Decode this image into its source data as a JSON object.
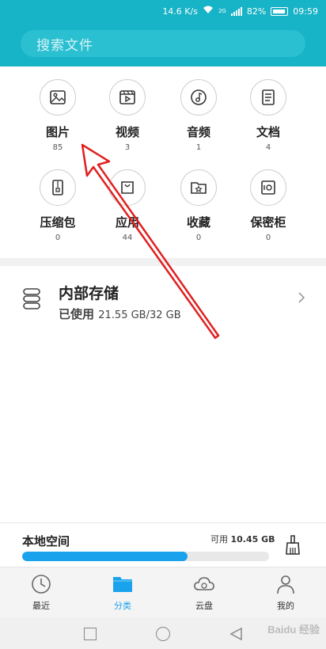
{
  "status": {
    "speed": "14.6 K/s",
    "network": "2G",
    "battery": "82%",
    "time": "09:59"
  },
  "search": {
    "placeholder": "搜索文件"
  },
  "categories": [
    {
      "label": "图片",
      "count": "85",
      "icon": "image-icon"
    },
    {
      "label": "视频",
      "count": "3",
      "icon": "video-icon"
    },
    {
      "label": "音频",
      "count": "1",
      "icon": "music-icon"
    },
    {
      "label": "文档",
      "count": "4",
      "icon": "document-icon"
    },
    {
      "label": "压缩包",
      "count": "0",
      "icon": "zip-icon"
    },
    {
      "label": "应用",
      "count": "44",
      "icon": "app-bag-icon"
    },
    {
      "label": "收藏",
      "count": "0",
      "icon": "star-folder-icon"
    },
    {
      "label": "保密柜",
      "count": "0",
      "icon": "safe-icon"
    }
  ],
  "storage": {
    "title": "内部存储",
    "used_label": "已使用",
    "used_value": "21.55 GB/32 GB"
  },
  "local_space": {
    "title": "本地空间",
    "available_label": "可用",
    "available_value": "10.45 GB",
    "used_fraction": 0.67
  },
  "nav": [
    {
      "label": "最近",
      "icon": "clock-icon",
      "active": false
    },
    {
      "label": "分类",
      "icon": "folder-icon",
      "active": true
    },
    {
      "label": "云盘",
      "icon": "cloud-icon",
      "active": false
    },
    {
      "label": "我的",
      "icon": "person-icon",
      "active": false
    }
  ],
  "colors": {
    "header": "#17b3c6",
    "accent": "#1aa3ec",
    "annotation_arrow": "#e02020"
  },
  "watermark": "Baidu 经验"
}
